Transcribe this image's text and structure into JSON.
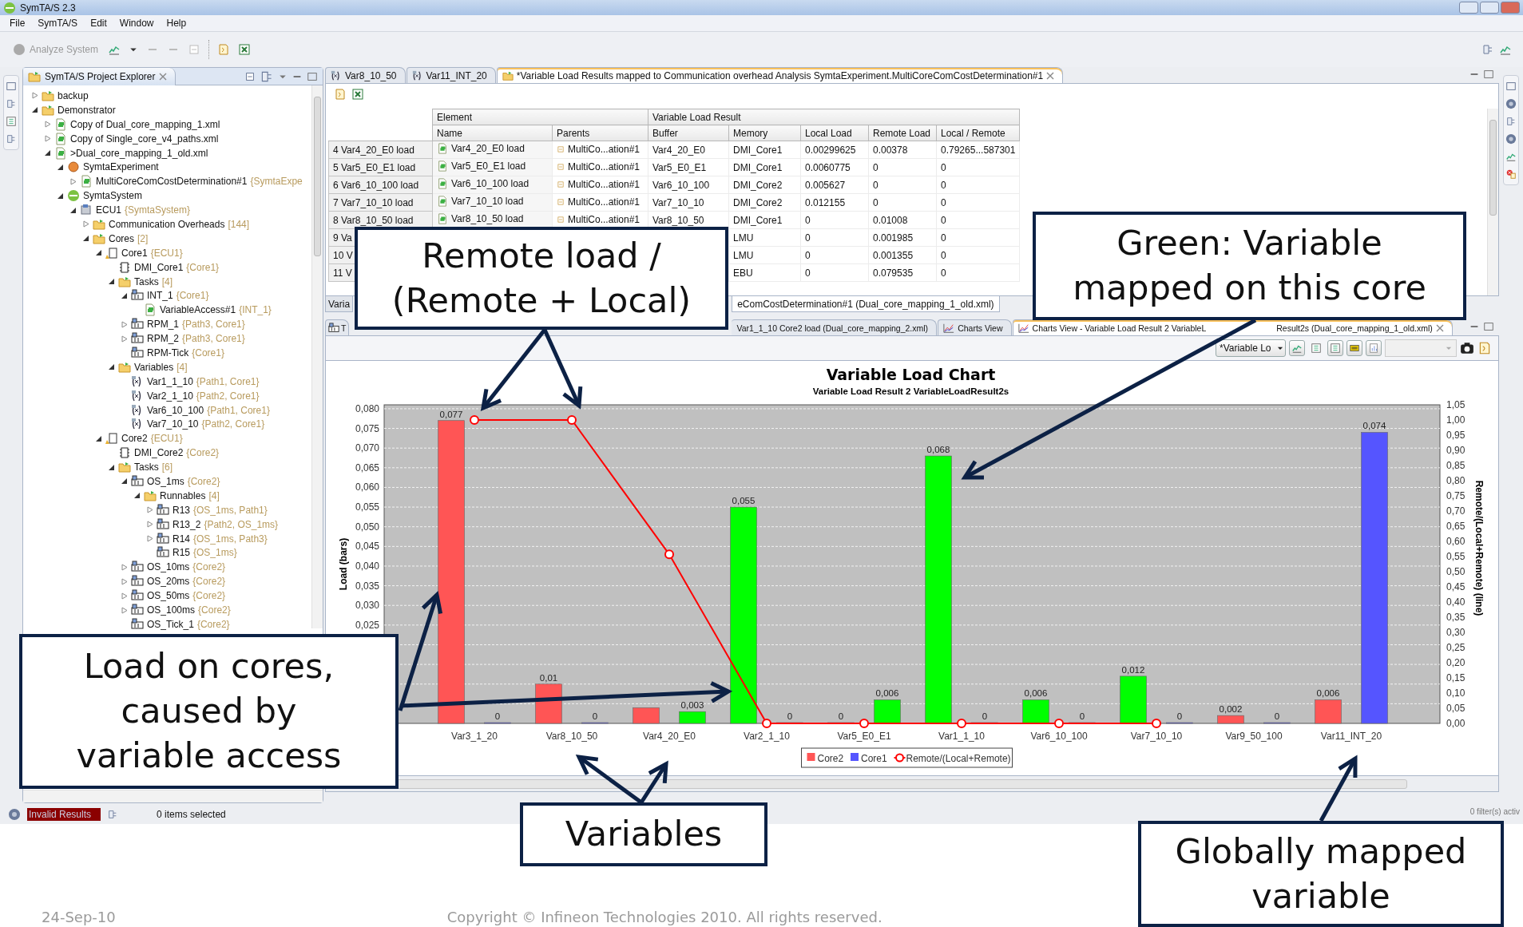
{
  "window": {
    "title": "SymTA/S 2.3"
  },
  "menu": [
    "File",
    "SymTA/S",
    "Edit",
    "Window",
    "Help"
  ],
  "toolbar": {
    "analyze": {
      "label": "Analyze System",
      "disabled": true
    }
  },
  "explorer": {
    "title": "SymTA/S Project Explorer",
    "tree": [
      {
        "label": "backup",
        "kind": "folder",
        "expanded": false
      },
      {
        "label": "Demonstrator",
        "kind": "folder",
        "expanded": true,
        "children": [
          {
            "label": "Copy of Dual_core_mapping_1.xml",
            "kind": "file",
            "expanded": false
          },
          {
            "label": "Copy of Single_core_v4_paths.xml",
            "kind": "file",
            "expanded": false
          },
          {
            "label": ">Dual_core_mapping_1_old.xml",
            "kind": "file",
            "expanded": true,
            "children": [
              {
                "label": "SymtaExperiment",
                "kind": "experiment",
                "expanded": true,
                "children": [
                  {
                    "label": "MultiCoreComCostDetermination#1",
                    "note": "{SymtaExpe",
                    "kind": "file",
                    "expanded": false
                  }
                ]
              },
              {
                "label": "SymtaSystem",
                "kind": "system",
                "expanded": true,
                "children": [
                  {
                    "label": "ECU1",
                    "note": "{SymtaSystem}",
                    "kind": "ecu",
                    "expanded": true,
                    "children": [
                      {
                        "label": "Communication Overheads",
                        "note": "[144]",
                        "kind": "folder",
                        "expanded": false
                      },
                      {
                        "label": "Cores",
                        "note": "[2]",
                        "kind": "folder",
                        "expanded": true,
                        "children": [
                          {
                            "label": "Core1",
                            "note": "{ECU1}",
                            "kind": "core",
                            "expanded": true,
                            "children": [
                              {
                                "label": "DMI_Core1",
                                "note": "{Core1}",
                                "kind": "chip"
                              },
                              {
                                "label": "Tasks",
                                "note": "[4]",
                                "kind": "folder",
                                "expanded": true,
                                "children": [
                                  {
                                    "label": "INT_1",
                                    "note": "{Core1}",
                                    "kind": "task",
                                    "expanded": true,
                                    "children": [
                                      {
                                        "label": "VariableAccess#1",
                                        "note": "{INT_1}",
                                        "kind": "file"
                                      }
                                    ]
                                  },
                                  {
                                    "label": "RPM_1",
                                    "note": "{Path3, Core1}",
                                    "kind": "task",
                                    "expanded": false
                                  },
                                  {
                                    "label": "RPM_2",
                                    "note": "{Path3, Core1}",
                                    "kind": "task",
                                    "expanded": false
                                  },
                                  {
                                    "label": "RPM-Tick",
                                    "note": "{Core1}",
                                    "kind": "task"
                                  }
                                ]
                              },
                              {
                                "label": "Variables",
                                "note": "[4]",
                                "kind": "folder",
                                "expanded": true,
                                "children": [
                                  {
                                    "label": "Var1_1_10",
                                    "note": "{Path1, Core1}",
                                    "kind": "variable"
                                  },
                                  {
                                    "label": "Var2_1_10",
                                    "note": "{Path2, Core1}",
                                    "kind": "variable"
                                  },
                                  {
                                    "label": "Var6_10_100",
                                    "note": "{Path1, Core1}",
                                    "kind": "variable"
                                  },
                                  {
                                    "label": "Var7_10_10",
                                    "note": "{Path2, Core1}",
                                    "kind": "variable"
                                  }
                                ]
                              }
                            ]
                          },
                          {
                            "label": "Core2",
                            "note": "{ECU1}",
                            "kind": "core",
                            "expanded": true,
                            "children": [
                              {
                                "label": "DMI_Core2",
                                "note": "{Core2}",
                                "kind": "chip"
                              },
                              {
                                "label": "Tasks",
                                "note": "[6]",
                                "kind": "folder",
                                "expanded": true,
                                "children": [
                                  {
                                    "label": "OS_1ms",
                                    "note": "{Core2}",
                                    "kind": "task",
                                    "expanded": true,
                                    "children": [
                                      {
                                        "label": "Runnables",
                                        "note": "[4]",
                                        "kind": "folder",
                                        "expanded": true,
                                        "children": [
                                          {
                                            "label": "R13",
                                            "note": "{OS_1ms, Path1}",
                                            "kind": "task",
                                            "expanded": false
                                          },
                                          {
                                            "label": "R13_2",
                                            "note": "{Path2, OS_1ms}",
                                            "kind": "task",
                                            "expanded": false
                                          },
                                          {
                                            "label": "R14",
                                            "note": "{OS_1ms, Path3}",
                                            "kind": "task",
                                            "expanded": false
                                          },
                                          {
                                            "label": "R15",
                                            "note": "{OS_1ms}",
                                            "kind": "task"
                                          }
                                        ]
                                      }
                                    ]
                                  },
                                  {
                                    "label": "OS_10ms",
                                    "note": "{Core2}",
                                    "kind": "task",
                                    "expanded": false
                                  },
                                  {
                                    "label": "OS_20ms",
                                    "note": "{Core2}",
                                    "kind": "task",
                                    "expanded": false
                                  },
                                  {
                                    "label": "OS_50ms",
                                    "note": "{Core2}",
                                    "kind": "task",
                                    "expanded": false
                                  },
                                  {
                                    "label": "OS_100ms",
                                    "note": "{Core2}",
                                    "kind": "task",
                                    "expanded": false
                                  },
                                  {
                                    "label": "OS_Tick_1",
                                    "note": "{Core2}",
                                    "kind": "task"
                                  }
                                ]
                              }
                            ]
                          }
                        ]
                      }
                    ]
                  }
                ]
              }
            ]
          }
        ]
      }
    ]
  },
  "editor": {
    "tabs": [
      {
        "label": "Var8_10_50",
        "kind": "variable",
        "selected": false
      },
      {
        "label": "Var11_INT_20",
        "kind": "variable",
        "selected": false
      },
      {
        "label": "*Variable Load Results mapped to Communication overhead Analysis SymtaExperiment.MultiCoreComCostDetermination#1",
        "kind": "folder",
        "selected": true
      }
    ],
    "table": {
      "groups": [
        "Element",
        "Variable Load Result"
      ],
      "columns": [
        "Name",
        "Parents",
        "Buffer",
        "Memory",
        "Local Load",
        "Remote Load",
        "Local / Remote"
      ],
      "rows": [
        {
          "header": "4 Var4_20_E0 load",
          "name": "Var4_20_E0 load",
          "parents": "MultiCo...ation#1",
          "buffer": "Var4_20_E0",
          "memory": "DMI_Core1",
          "local_load": "0.00299625",
          "remote_load": "0.00378",
          "local_remote": "0.79265...587301"
        },
        {
          "header": "5 Var5_E0_E1 load",
          "name": "Var5_E0_E1 load",
          "parents": "MultiCo...ation#1",
          "buffer": "Var5_E0_E1",
          "memory": "DMI_Core1",
          "local_load": "0.0060775",
          "remote_load": "0",
          "local_remote": "0"
        },
        {
          "header": "6 Var6_10_100 load",
          "name": "Var6_10_100 load",
          "parents": "MultiCo...ation#1",
          "buffer": "Var6_10_100",
          "memory": "DMI_Core2",
          "local_load": "0.005627",
          "remote_load": "0",
          "local_remote": "0"
        },
        {
          "header": "7 Var7_10_10 load",
          "name": "Var7_10_10 load",
          "parents": "MultiCo...ation#1",
          "buffer": "Var7_10_10",
          "memory": "DMI_Core2",
          "local_load": "0.012155",
          "remote_load": "0",
          "local_remote": "0"
        },
        {
          "header": "8 Var8_10_50 load",
          "name": "Var8_10_50 load",
          "parents": "MultiCo...ation#1",
          "buffer": "Var8_10_50",
          "memory": "DMI_Core1",
          "local_load": "0",
          "remote_load": "0.01008",
          "local_remote": "0"
        },
        {
          "header": "9 Va",
          "memory": "LMU",
          "local_load": "0",
          "remote_load": "0.001985",
          "local_remote": "0"
        },
        {
          "header": "10 V",
          "memory": "LMU",
          "local_load": "0",
          "remote_load": "0.001355",
          "local_remote": "0"
        },
        {
          "header": "11 V",
          "memory": "EBU",
          "local_load": "0",
          "remote_load": "0.079535",
          "local_remote": "0"
        }
      ]
    },
    "page_tabs": [
      {
        "label": "Varia",
        "selected": false
      },
      {
        "label": "eComCostDetermination#1 (Dual_core_mapping_1_old.xml)",
        "selected": true
      }
    ]
  },
  "charts_panel": {
    "tabs": [
      {
        "label": "T",
        "kind": "task",
        "selected": false
      },
      {
        "label": "Var1_1_10 Core2 load (Dual_core_mapping_2.xml)",
        "kind": "plain",
        "selected": false
      },
      {
        "label": "Charts View",
        "kind": "chart",
        "selected": false
      },
      {
        "label": "Charts View - Variable Load Result 2 VariableL",
        "label_2": "Result2s (Dual_core_mapping_1_old.xml)",
        "kind": "chart",
        "selected": true
      }
    ],
    "dropdown": "*Variable Lo",
    "chart_data": {
      "type": "bar",
      "title": "Variable Load Chart",
      "subtitle": "Variable Load Result 2 VariableLoadResult2s",
      "ylabel": "Load (bars)",
      "y2label": "Remote/(Local+Remote) (line)",
      "categories": [
        "Var3_1_20",
        "Var8_10_50",
        "Var4_20_E0",
        "Var2_1_10",
        "Var5_E0_E1",
        "Var1_1_10",
        "Var6_10_100",
        "Var7_10_10",
        "Var9_50_100",
        "Var11_INT_20"
      ],
      "series": [
        {
          "name": "Core2",
          "color": "#ff5555",
          "values": [
            0.077,
            0.01,
            0.004,
            null,
            0,
            null,
            null,
            null,
            0.002,
            0.006
          ],
          "value_labels": [
            "0,077",
            "0,01",
            null,
            null,
            "0",
            null,
            null,
            null,
            "0,002",
            "0,006"
          ]
        },
        {
          "name": "Core1",
          "color": "#5555ff",
          "values": [
            0,
            0,
            null,
            0,
            null,
            0,
            0,
            0,
            0,
            0.074
          ],
          "value_labels": [
            "0",
            "0",
            null,
            "0",
            null,
            "0",
            "0",
            "0",
            "0",
            "0,074"
          ]
        },
        {
          "color": "#00ff00",
          "values": [
            null,
            null,
            null,
            0.055,
            null,
            0.068,
            0.006,
            0.012,
            null,
            null
          ],
          "value_labels": [
            null,
            null,
            null,
            "0,055",
            null,
            "0,068",
            "0,006",
            "0,012",
            null,
            null
          ]
        },
        {
          "color": "#00ff00",
          "values": [
            null,
            null,
            0.003,
            null,
            0.006,
            null,
            null,
            null,
            null,
            null
          ],
          "value_labels": [
            null,
            null,
            "0,003",
            null,
            "0,006",
            null,
            null,
            null,
            null,
            null
          ]
        },
        {
          "name": "Remote/(Local+Remote)",
          "type": "line",
          "axis": "y2",
          "marker": "circle",
          "color": "#ff0000",
          "values": [
            1.0,
            1.0,
            0.557,
            0,
            0,
            0,
            0,
            0,
            null,
            null
          ],
          "value_labels": [
            null,
            null,
            null,
            null,
            null,
            null,
            null,
            null,
            null,
            null
          ]
        }
      ],
      "grid": true,
      "legend": "bottom",
      "ylim": [
        0,
        0.081
      ],
      "y2lim": [
        0,
        1.05
      ],
      "yticks": [
        {
          "value": 0.025,
          "label": "0,025"
        },
        {
          "value": 0.03,
          "label": "0,030"
        },
        {
          "value": 0.035,
          "label": "0,035"
        },
        {
          "value": 0.04,
          "label": "0,040"
        },
        {
          "value": 0.045,
          "label": "0,045"
        },
        {
          "value": 0.05,
          "label": "0,050"
        },
        {
          "value": 0.055,
          "label": "0,055"
        },
        {
          "value": 0.06,
          "label": "0,060"
        },
        {
          "value": 0.065,
          "label": "0,065"
        },
        {
          "value": 0.07,
          "label": "0,070"
        },
        {
          "value": 0.075,
          "label": "0,075"
        },
        {
          "value": 0.08,
          "label": "0,080"
        }
      ],
      "y2ticks": [
        {
          "value": 0,
          "label": "0,00"
        },
        {
          "value": 0.05,
          "label": "0,05"
        },
        {
          "value": 0.1,
          "label": "0,10"
        },
        {
          "value": 0.15,
          "label": "0,15"
        },
        {
          "value": 0.2,
          "label": "0,20"
        },
        {
          "value": 0.25,
          "label": "0,25"
        },
        {
          "value": 0.3,
          "label": "0,30"
        },
        {
          "value": 0.35,
          "label": "0,35"
        },
        {
          "value": 0.4,
          "label": "0,40"
        },
        {
          "value": 0.45,
          "label": "0,45"
        },
        {
          "value": 0.5,
          "label": "0,50"
        },
        {
          "value": 0.55,
          "label": "0,55"
        },
        {
          "value": 0.6,
          "label": "0,60"
        },
        {
          "value": 0.65,
          "label": "0,65"
        },
        {
          "value": 0.7,
          "label": "0,70"
        },
        {
          "value": 0.75,
          "label": "0,75"
        },
        {
          "value": 0.8,
          "label": "0,80"
        },
        {
          "value": 0.85,
          "label": "0,85"
        },
        {
          "value": 0.9,
          "label": "0,90"
        },
        {
          "value": 0.95,
          "label": "0,95"
        },
        {
          "value": 1.0,
          "label": "1,00"
        },
        {
          "value": 1.05,
          "label": "1,05"
        }
      ],
      "data_labels": true
    }
  },
  "status_bar": {
    "badge": "Invalid Results",
    "selection": "0 items selected",
    "filters": "0 filter(s) activ"
  },
  "callouts": [
    {
      "text": "Remote load /\n(Remote + Local)"
    },
    {
      "text": "Green:  Variable\nmapped on this core"
    },
    {
      "text": "Load on cores,\ncaused by\nvariable access"
    },
    {
      "text": "Variables"
    },
    {
      "text": "Globally mapped\nvariable"
    }
  ],
  "footer": {
    "date": "24-Sep-10",
    "copyright": "Copyright © Infineon Technologies 2010. All rights reserved."
  }
}
